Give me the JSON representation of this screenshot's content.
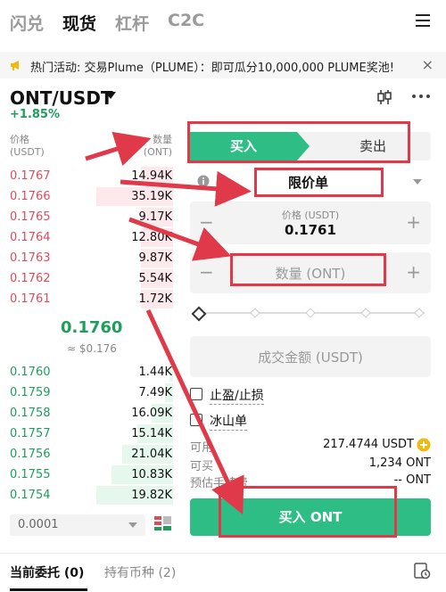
{
  "top_tabs": [
    {
      "label": "闪兑",
      "active": false
    },
    {
      "label": "现货",
      "active": true
    },
    {
      "label": "杠杆",
      "active": false
    },
    {
      "label": "C2C",
      "active": false
    }
  ],
  "promo": {
    "text": "热门活动: 交易Plume（PLUME）：即可瓜分10,000,000 PLUME奖池!",
    "close": "×"
  },
  "pair": {
    "name": "ONT/USDT",
    "change": "+1.85%"
  },
  "orderbook": {
    "price_header": [
      "价格",
      "(USDT)"
    ],
    "qty_header": [
      "数量",
      "(ONT)"
    ],
    "asks": [
      {
        "price": "0.1767",
        "qty": "14.94K",
        "depth": 0.42
      },
      {
        "price": "0.1766",
        "qty": "35.19K",
        "depth": 1.0
      },
      {
        "price": "0.1765",
        "qty": "9.17K",
        "depth": 0.42
      },
      {
        "price": "0.1764",
        "qty": "12.80K",
        "depth": 0.42
      },
      {
        "price": "0.1763",
        "qty": "9.87K",
        "depth": 0.42
      },
      {
        "price": "0.1762",
        "qty": "5.54K",
        "depth": 0.42
      },
      {
        "price": "0.1761",
        "qty": "1.72K",
        "depth": 0.42
      }
    ],
    "mid_price": "0.1760",
    "mid_fiat": "≈ $0.176",
    "bids": [
      {
        "price": "0.1760",
        "qty": "1.44K",
        "depth": 0.05
      },
      {
        "price": "0.1759",
        "qty": "7.49K",
        "depth": 0.1
      },
      {
        "price": "0.1758",
        "qty": "16.09K",
        "depth": 0.28
      },
      {
        "price": "0.1757",
        "qty": "15.14K",
        "depth": 0.47
      },
      {
        "price": "0.1756",
        "qty": "21.04K",
        "depth": 0.66
      },
      {
        "price": "0.1755",
        "qty": "10.83K",
        "depth": 0.8
      },
      {
        "price": "0.1754",
        "qty": "19.82K",
        "depth": 1.0
      }
    ],
    "precision": "0.0001"
  },
  "form": {
    "buy_tab": "买入",
    "sell_tab": "卖出",
    "order_type": "限价单",
    "price_label": "价格 (USDT)",
    "price_value": "0.1761",
    "qty_placeholder": "数量 (ONT)",
    "minus": "−",
    "plus": "+",
    "amount_placeholder": "成交金额 (USDT)",
    "tpsl_label": "止盈/止损",
    "iceberg_label": "冰山单",
    "available_label": "可用",
    "available_value": "217.4744 USDT",
    "can_buy_label": "可买",
    "can_buy_value": "1,234 ONT",
    "fee_label": "预估手续费",
    "fee_value": "-- ONT",
    "submit_label": "买入 ONT"
  },
  "bottom_tabs": [
    {
      "label": "当前委托 (0)",
      "active": true
    },
    {
      "label": "持有币种 (2)",
      "active": false
    }
  ],
  "colors": {
    "buy_green": "#2ebd85",
    "ask_red": "#e04b5c",
    "bid_green": "#1e9e5a",
    "annotation_red": "#e0394a"
  }
}
